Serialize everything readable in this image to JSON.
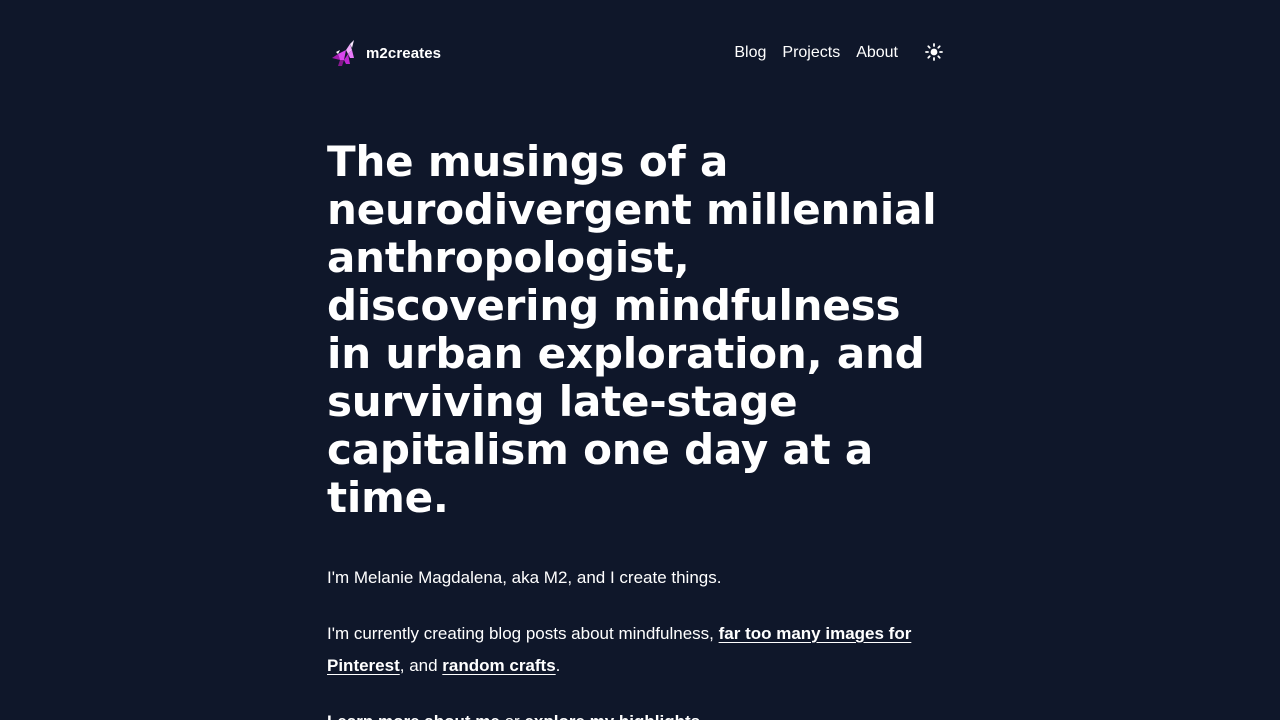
{
  "header": {
    "brand_name": "m2creates",
    "nav": [
      {
        "label": "Blog"
      },
      {
        "label": "Projects"
      },
      {
        "label": "About"
      }
    ],
    "theme_icon": "sun-icon"
  },
  "hero": {
    "headline": "The musings of a neurodivergent millennial anthropologist, discovering mindfulness in urban exploration, and surviving late-stage capitalism one day at a time."
  },
  "content": {
    "intro": "I'm Melanie Magdalena, aka M2, and I create things.",
    "para2_before": "I'm currently creating blog posts about mindfulness, ",
    "para2_link1": "far too many images for Pinterest",
    "para2_mid": ", and ",
    "para2_link2": "random crafts",
    "para2_after": ".",
    "para3_link1": "Learn more about me",
    "para3_mid": " or ",
    "para3_link2": "explore my highlights",
    "para3_after": "."
  },
  "colors": {
    "background": "#0f172a",
    "text": "#ffffff",
    "logo_accent": "#d946ef"
  }
}
